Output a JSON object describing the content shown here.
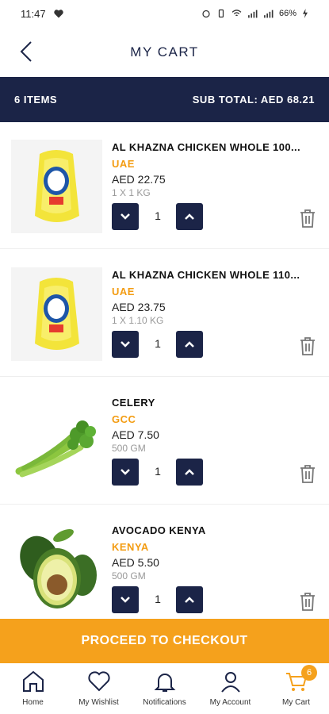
{
  "status_bar": {
    "time": "11:47",
    "battery": "66%"
  },
  "header": {
    "title": "MY CART",
    "back_icon": "chevron-left-icon"
  },
  "summary": {
    "items_count": "6 ITEMS",
    "subtotal": "SUB TOTAL: AED 68.21"
  },
  "items": [
    {
      "name": "AL KHAZNA CHICKEN WHOLE 100...",
      "origin": "UAE",
      "price": "AED 22.75",
      "unit": "1 X 1 KG",
      "quantity": "1",
      "image": "chicken"
    },
    {
      "name": "AL KHAZNA CHICKEN WHOLE 110...",
      "origin": "UAE",
      "price": "AED 23.75",
      "unit": "1 X 1.10 KG",
      "quantity": "1",
      "image": "chicken"
    },
    {
      "name": "CELERY",
      "origin": "GCC",
      "price": "AED 7.50",
      "unit": "500 GM",
      "quantity": "1",
      "image": "celery"
    },
    {
      "name": "AVOCADO KENYA",
      "origin": "KENYA",
      "price": "AED 5.50",
      "unit": "500 GM",
      "quantity": "1",
      "image": "avocado"
    }
  ],
  "checkout": {
    "label": "PROCEED TO CHECKOUT"
  },
  "nav": {
    "home": "Home",
    "wishlist": "My Wishlist",
    "notifications": "Notifications",
    "account": "My Account",
    "cart": "My Cart",
    "cart_badge": "6"
  },
  "colors": {
    "navy": "#1b2447",
    "orange": "#f5a11c",
    "origin_orange": "#f39c12"
  }
}
